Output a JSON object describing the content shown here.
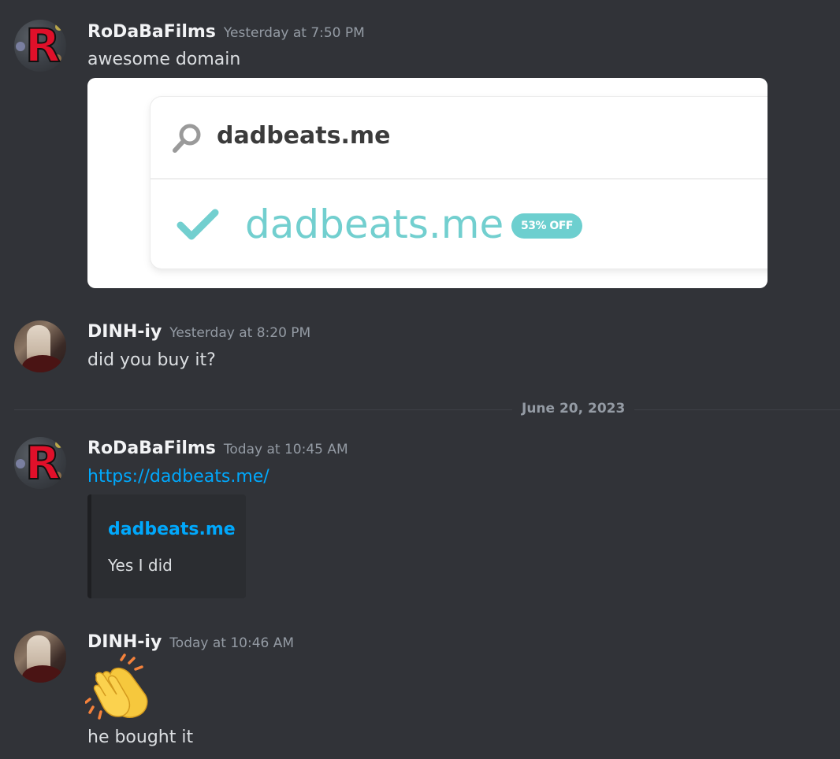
{
  "messages": [
    {
      "author": "RoDaBaFilms",
      "timestamp": "Yesterday at 7:50 PM",
      "avatar_icon": "r-logo-avatar-icon",
      "text": "awesome domain",
      "image": {
        "search_query": "dadbeats.me",
        "result_domain": "dadbeats.me",
        "badge": "53% OFF",
        "accent_color": "#72cfcf"
      }
    },
    {
      "author": "DINH-iy",
      "timestamp": "Yesterday at 8:20 PM",
      "avatar_icon": "photo-avatar-icon",
      "text": "did you buy it?"
    },
    {
      "author": "RoDaBaFilms",
      "timestamp": "Today at 10:45 AM",
      "avatar_icon": "r-logo-avatar-icon",
      "link": "https://dadbeats.me/",
      "embed": {
        "title": "dadbeats.me",
        "description": "Yes I did"
      }
    },
    {
      "author": "DINH-iy",
      "timestamp": "Today at 10:46 AM",
      "avatar_icon": "photo-avatar-icon",
      "emoji": "clapping-hands-icon",
      "text": "he bought it"
    }
  ],
  "divider": {
    "date": "June 20, 2023"
  },
  "colors": {
    "background": "#313338",
    "link": "#00a8fc",
    "username": "#f2f3f5",
    "timestamp": "#949ba4",
    "message_text": "#dbdee1"
  }
}
